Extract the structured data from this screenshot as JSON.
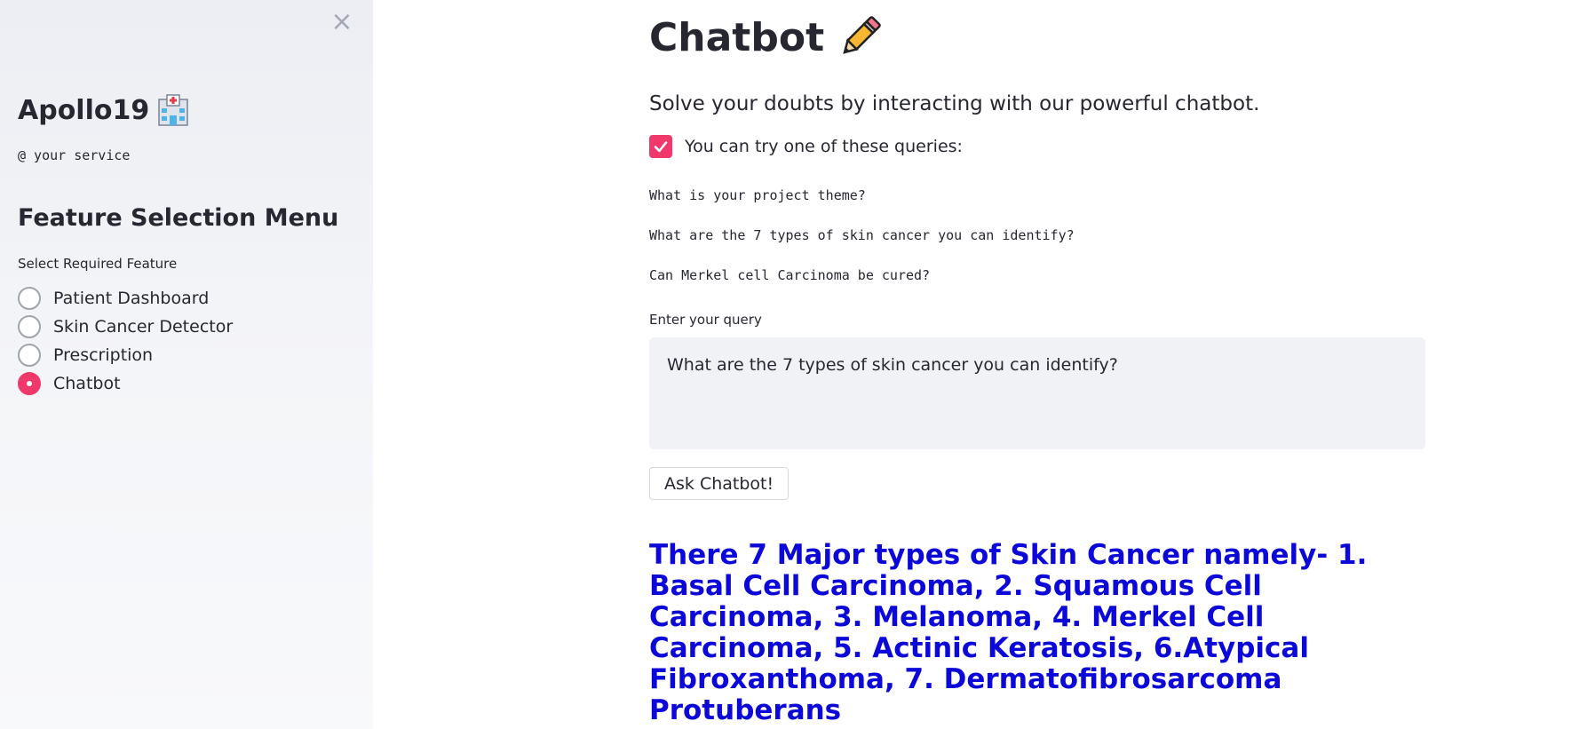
{
  "sidebar": {
    "close_symbol": "×",
    "brand": "Apollo19",
    "brand_icon": "hospital-icon",
    "tagline": "@ your service",
    "menu_title": "Feature Selection Menu",
    "radio_label": "Select Required Feature",
    "options": [
      {
        "label": "Patient Dashboard",
        "selected": false
      },
      {
        "label": "Skin Cancer Detector",
        "selected": false
      },
      {
        "label": "Prescription",
        "selected": false
      },
      {
        "label": "Chatbot",
        "selected": true
      }
    ]
  },
  "main": {
    "title": "Chatbot",
    "title_icon": "pencil-icon",
    "subtitle": "Solve your doubts by interacting with our powerful chatbot.",
    "checkbox_label": "You can try one of these queries:",
    "checkbox_checked": true,
    "queries": [
      "What is your project theme?",
      "What are the 7 types of skin cancer you can identify?",
      "Can Merkel cell Carcinoma be cured?"
    ],
    "input_label": "Enter your query",
    "input_value": "What are the 7 types of skin cancer you can identify?",
    "button_label": "Ask Chatbot!",
    "answer": "There 7 Major types of Skin Cancer namely- 1. Basal Cell Carcinoma, 2. Squamous Cell Carcinoma, 3. Melanoma, 4. Merkel Cell Carcinoma, 5. Actinic Keratosis, 6.Atypical Fibroxanthoma, 7. Dermatofibrosarcoma Protuberans"
  },
  "colors": {
    "accent": "#f0386b",
    "answer_text": "#0c08d8",
    "sidebar_bg": "#f0f2f6"
  }
}
